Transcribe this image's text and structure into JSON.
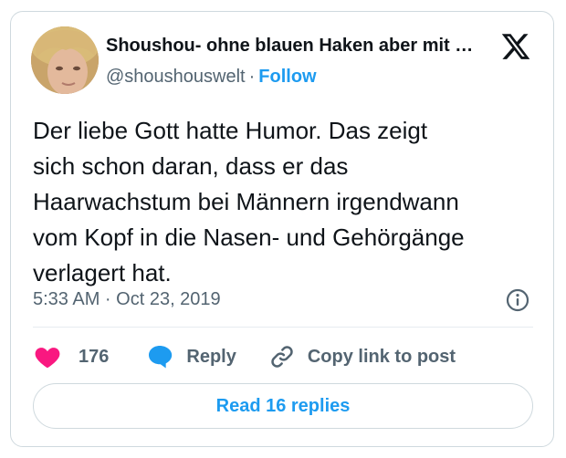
{
  "author": {
    "display_name": "Shoushou- ohne blauen Haken aber mit …",
    "handle": "@shoushouswelt",
    "separator": "·",
    "follow_label": "Follow"
  },
  "tweet": {
    "text": "Der liebe Gott hatte Humor. Das zeigt\nsich schon daran, dass er das\nHaarwachstum bei Männern irgendwann\nvom Kopf in die Nasen- und Gehörgänge\nverlagert hat.",
    "timestamp": "5:33 AM · Oct 23, 2019"
  },
  "actions": {
    "like_count": "176",
    "reply_label": "Reply",
    "copy_link_label": "Copy link to post"
  },
  "read_replies_label": "Read 16 replies",
  "colors": {
    "accent": "#1d9bf0",
    "like": "#f91880",
    "text": "#0f1419",
    "muted": "#536471"
  },
  "icons": [
    "x-logo-icon",
    "info-icon",
    "heart-icon",
    "speech-bubble-icon",
    "link-icon"
  ]
}
